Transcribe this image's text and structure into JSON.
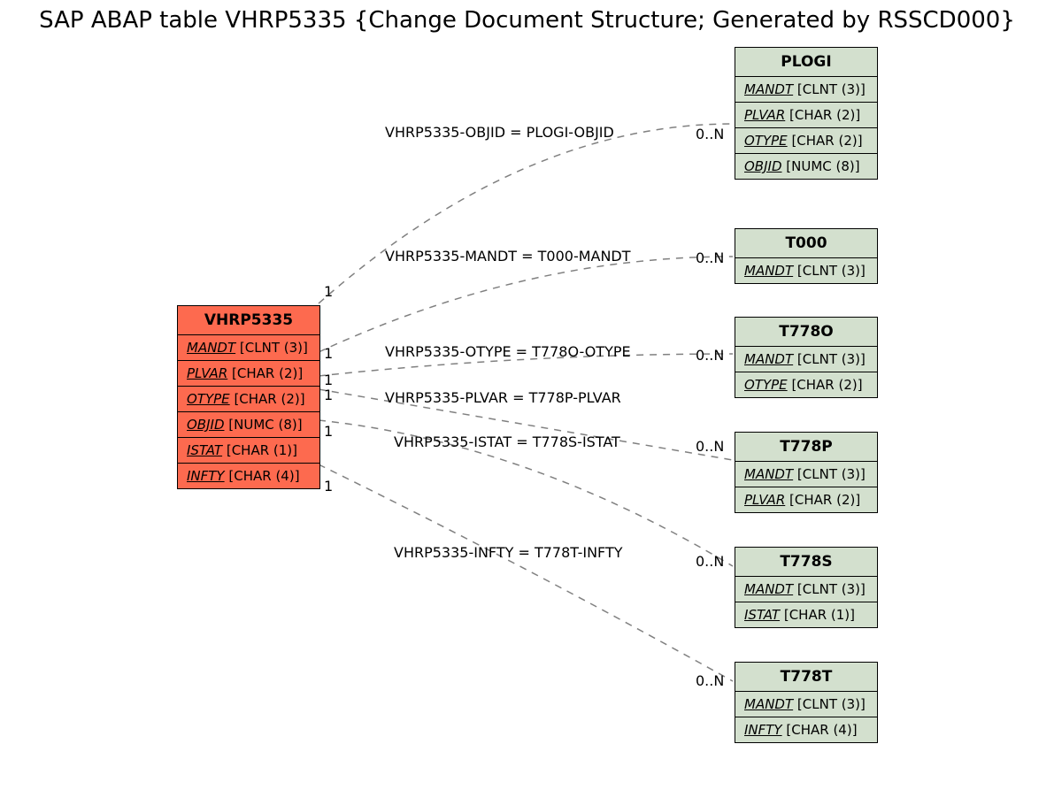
{
  "title": "SAP ABAP table VHRP5335 {Change Document Structure; Generated by RSSCD000}",
  "main": {
    "name": "VHRP5335",
    "fields": [
      {
        "name": "MANDT",
        "type": "[CLNT (3)]"
      },
      {
        "name": "PLVAR",
        "type": "[CHAR (2)]"
      },
      {
        "name": "OTYPE",
        "type": "[CHAR (2)]"
      },
      {
        "name": "OBJID",
        "type": "[NUMC (8)]"
      },
      {
        "name": "ISTAT",
        "type": "[CHAR (1)]"
      },
      {
        "name": "INFTY",
        "type": "[CHAR (4)]"
      }
    ]
  },
  "related": [
    {
      "name": "PLOGI",
      "fields": [
        {
          "name": "MANDT",
          "type": "[CLNT (3)]"
        },
        {
          "name": "PLVAR",
          "type": "[CHAR (2)]"
        },
        {
          "name": "OTYPE",
          "type": "[CHAR (2)]"
        },
        {
          "name": "OBJID",
          "type": "[NUMC (8)]"
        }
      ]
    },
    {
      "name": "T000",
      "fields": [
        {
          "name": "MANDT",
          "type": "[CLNT (3)]"
        }
      ]
    },
    {
      "name": "T778O",
      "fields": [
        {
          "name": "MANDT",
          "type": "[CLNT (3)]"
        },
        {
          "name": "OTYPE",
          "type": "[CHAR (2)]"
        }
      ]
    },
    {
      "name": "T778P",
      "fields": [
        {
          "name": "MANDT",
          "type": "[CLNT (3)]"
        },
        {
          "name": "PLVAR",
          "type": "[CHAR (2)]"
        }
      ]
    },
    {
      "name": "T778S",
      "fields": [
        {
          "name": "MANDT",
          "type": "[CLNT (3)]"
        },
        {
          "name": "ISTAT",
          "type": "[CHAR (1)]"
        }
      ]
    },
    {
      "name": "T778T",
      "fields": [
        {
          "name": "MANDT",
          "type": "[CLNT (3)]"
        },
        {
          "name": "INFTY",
          "type": "[CHAR (4)]"
        }
      ]
    }
  ],
  "relations": [
    {
      "label": "VHRP5335-OBJID = PLOGI-OBJID",
      "left_card": "1",
      "right_card": "0..N"
    },
    {
      "label": "VHRP5335-MANDT = T000-MANDT",
      "left_card": "1",
      "right_card": "0..N"
    },
    {
      "label": "VHRP5335-OTYPE = T778O-OTYPE",
      "left_card": "1",
      "right_card": "0..N"
    },
    {
      "label": "VHRP5335-PLVAR = T778P-PLVAR",
      "left_card": "1",
      "right_card": "0..N"
    },
    {
      "label": "VHRP5335-ISTAT = T778S-ISTAT",
      "left_card": "1",
      "right_card": "0..N"
    },
    {
      "label": "VHRP5335-INFTY = T778T-INFTY",
      "left_card": "1",
      "right_card": "0..N"
    }
  ]
}
